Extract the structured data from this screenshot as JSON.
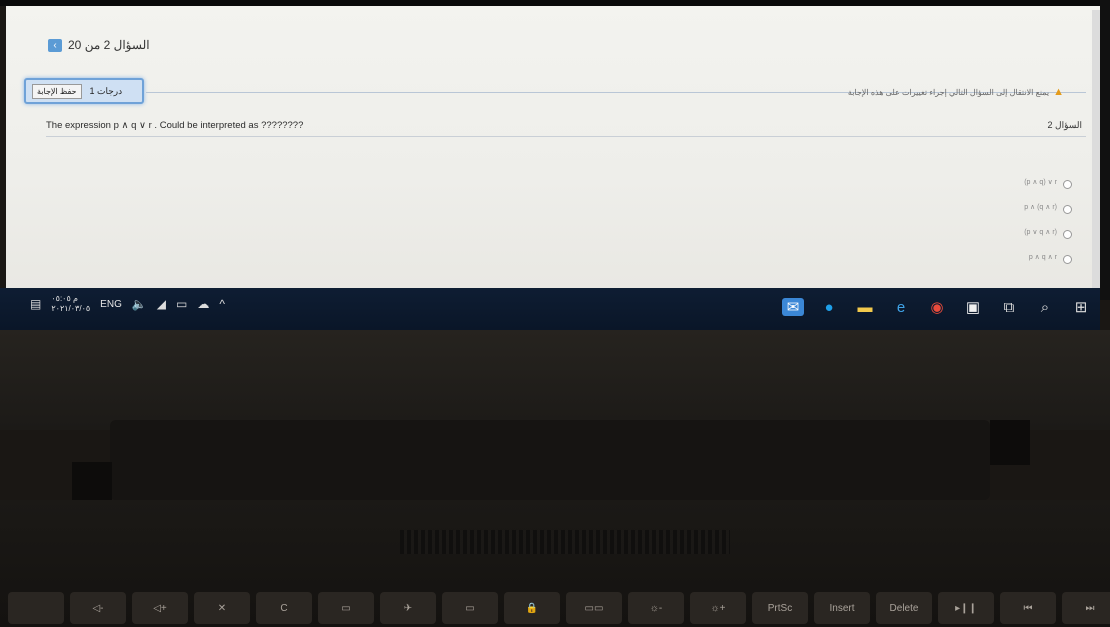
{
  "question_nav": {
    "label": "السؤال 2 من 20",
    "arrow_icon": "chevron-left-icon"
  },
  "header": {
    "save_label": "حفظ الإجابة",
    "points_label": "1 درجات",
    "warning_text": "يمنع الانتقال إلى السؤال التالي إجراء تغييرات على هذه الإجابة",
    "warning_icon": "warning-icon"
  },
  "question": {
    "number_label": "السؤال 2",
    "text": "The expression p ∧ q ∨ r . Could be interpreted as ????????",
    "options": [
      {
        "label": "(p ∧ q) ∨ r"
      },
      {
        "label": "p ∧ (q ∧ r)"
      },
      {
        "label": "(p ∨ q ∧ r)"
      },
      {
        "label": "p ∧ q ∧ r"
      }
    ]
  },
  "taskbar": {
    "lang": "ENG",
    "time": "م ٠٥:٠٥",
    "date": "٢٠٢١/٠٣/٠٥",
    "apps": [
      {
        "icon": "mail-icon",
        "color": "#3b87d6"
      },
      {
        "icon": "edge-icon",
        "color": "#1e9fe8"
      },
      {
        "icon": "explorer-icon",
        "color": "#f2c94c"
      },
      {
        "icon": "ie-icon",
        "color": "#3fa3e8"
      },
      {
        "icon": "chrome-icon",
        "color": "#e94b3c"
      },
      {
        "icon": "store-icon",
        "color": "#f0f0f0"
      },
      {
        "icon": "taskview-icon",
        "color": "#dddddd"
      },
      {
        "icon": "search-icon",
        "color": "#dddddd"
      },
      {
        "icon": "start-icon",
        "color": "#dddddd"
      }
    ]
  },
  "keyboard": {
    "keys": [
      "",
      "◁-",
      "◁+",
      "✕",
      "C",
      "▭",
      "✈",
      "▭",
      "🔒",
      "▭▭",
      "☼-",
      "☼+",
      "PrtSc",
      "Insert",
      "Delete",
      "▸❙❙",
      "⏮",
      "⏭"
    ]
  }
}
